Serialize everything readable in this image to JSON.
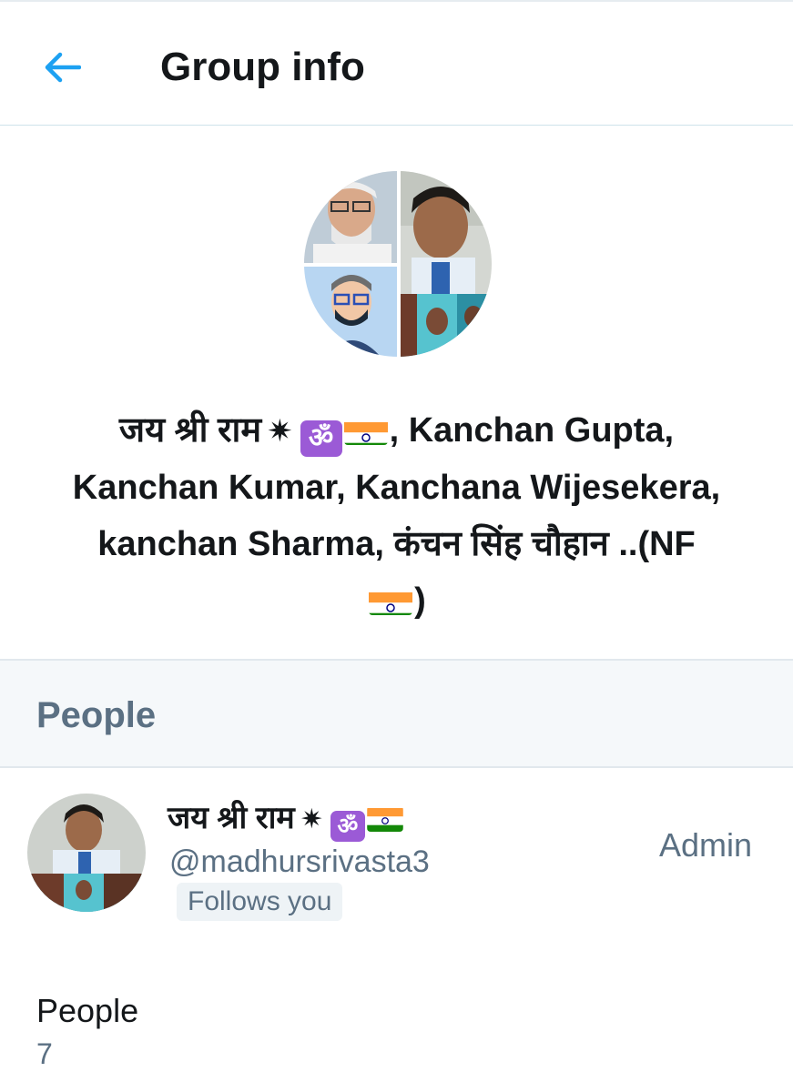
{
  "header": {
    "title": "Group info",
    "back_icon": "arrow-left-icon"
  },
  "group": {
    "name_part1": "जय श्री राम",
    "name_part2": ", Kanchan Gupta,",
    "name_line2": "Kanchan Kumar, Kanchana Wijesekera,",
    "name_line3": "kanchan Sharma, कंचन सिंह चौहान ..(NF",
    "name_end": ")",
    "om_symbol": "ॐ",
    "star_symbol": "✷"
  },
  "people_section": {
    "title": "People"
  },
  "member": {
    "name": "जय श्री राम",
    "om_symbol": "ॐ",
    "star_symbol": "✷",
    "handle": "@madhursrivasta3",
    "follows_badge": "Follows you",
    "role": "Admin"
  },
  "stats": {
    "label": "People",
    "value": "7"
  },
  "colors": {
    "accent": "#1da1f2",
    "secondary_text": "#5b7083",
    "section_bg": "#f5f8fa",
    "om_badge": "#9b5ad6"
  }
}
